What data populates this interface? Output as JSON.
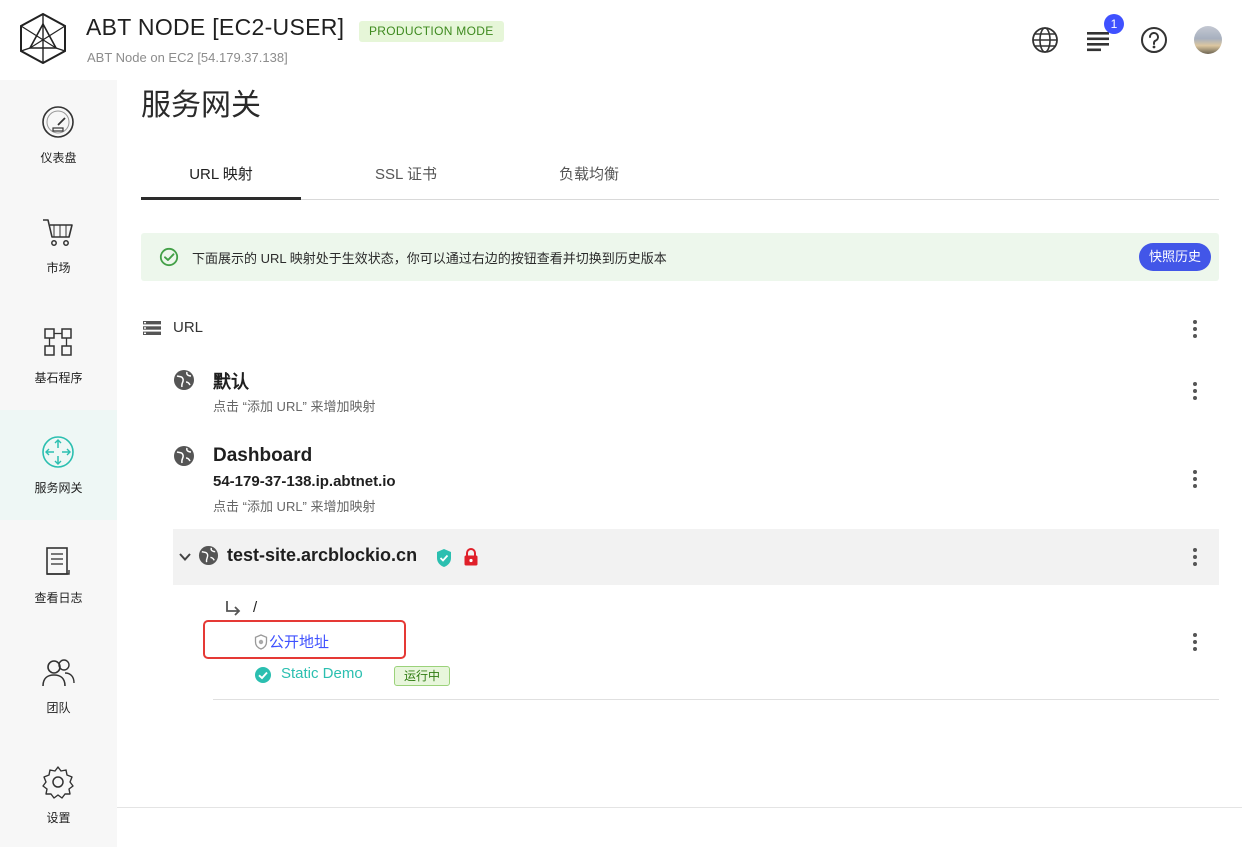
{
  "header": {
    "title": "ABT NODE [EC2-USER]",
    "mode_badge": "PRODUCTION MODE",
    "subtitle": "ABT Node on EC2 [54.179.37.138]",
    "notification_count": "1",
    "icons": [
      "globe-icon",
      "notifications-icon",
      "help-icon",
      "avatar"
    ]
  },
  "sidebar": {
    "items": [
      {
        "label": "仪表盘",
        "icon": "dashboard-gauge-icon"
      },
      {
        "label": "市场",
        "icon": "cart-icon"
      },
      {
        "label": "基石程序",
        "icon": "blocklets-icon"
      },
      {
        "label": "服务网关",
        "icon": "gateway-icon",
        "active": true
      },
      {
        "label": "查看日志",
        "icon": "log-icon"
      },
      {
        "label": "团队",
        "icon": "team-icon"
      },
      {
        "label": "设置",
        "icon": "settings-gear-icon"
      }
    ]
  },
  "main": {
    "page_title": "服务网关",
    "tabs": [
      {
        "label": "URL 映射",
        "active": true
      },
      {
        "label": "SSL 证书"
      },
      {
        "label": "负载均衡"
      }
    ],
    "alert": {
      "text": "下面展示的 URL 映射处于生效状态，你可以通过右边的按钮查看并切换到历史版本",
      "button": "快照历史"
    },
    "url_section": {
      "label": "URL",
      "groups": [
        {
          "title": "默认",
          "hint": "点击 “添加 URL” 来增加映射"
        },
        {
          "title": "Dashboard",
          "domain": "54-179-37-138.ip.abtnet.io",
          "hint": "点击 “添加 URL” 来增加映射"
        }
      ],
      "site": {
        "domain": "test-site.arcblockio.cn",
        "path": "/",
        "public_link": "公开地址",
        "app_name": "Static Demo",
        "status": "运行中"
      }
    }
  },
  "colors": {
    "accent": "#4256e8",
    "teal": "#2bbfb0",
    "lock_red": "#e0202a",
    "highlight_red": "#e53935"
  }
}
